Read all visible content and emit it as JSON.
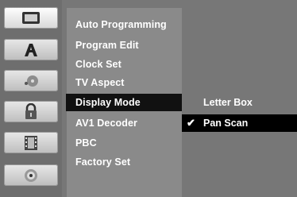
{
  "icons": [
    {
      "name": "display-icon"
    },
    {
      "name": "language-icon"
    },
    {
      "name": "audio-icon"
    },
    {
      "name": "lock-icon"
    },
    {
      "name": "film-icon"
    },
    {
      "name": "disc-icon"
    }
  ],
  "menu": {
    "items": [
      {
        "label": "Auto Programming"
      },
      {
        "label": "Program Edit"
      },
      {
        "label": "Clock Set"
      },
      {
        "label": "TV Aspect"
      },
      {
        "label": "Display Mode"
      },
      {
        "label": "AV1 Decoder"
      },
      {
        "label": "PBC"
      },
      {
        "label": "Factory Set"
      }
    ],
    "selected": "Display Mode"
  },
  "submenu": {
    "items": [
      {
        "label": "Letter Box"
      },
      {
        "label": "Pan Scan"
      }
    ],
    "selected": "Pan Scan",
    "checkmark": "✔"
  }
}
